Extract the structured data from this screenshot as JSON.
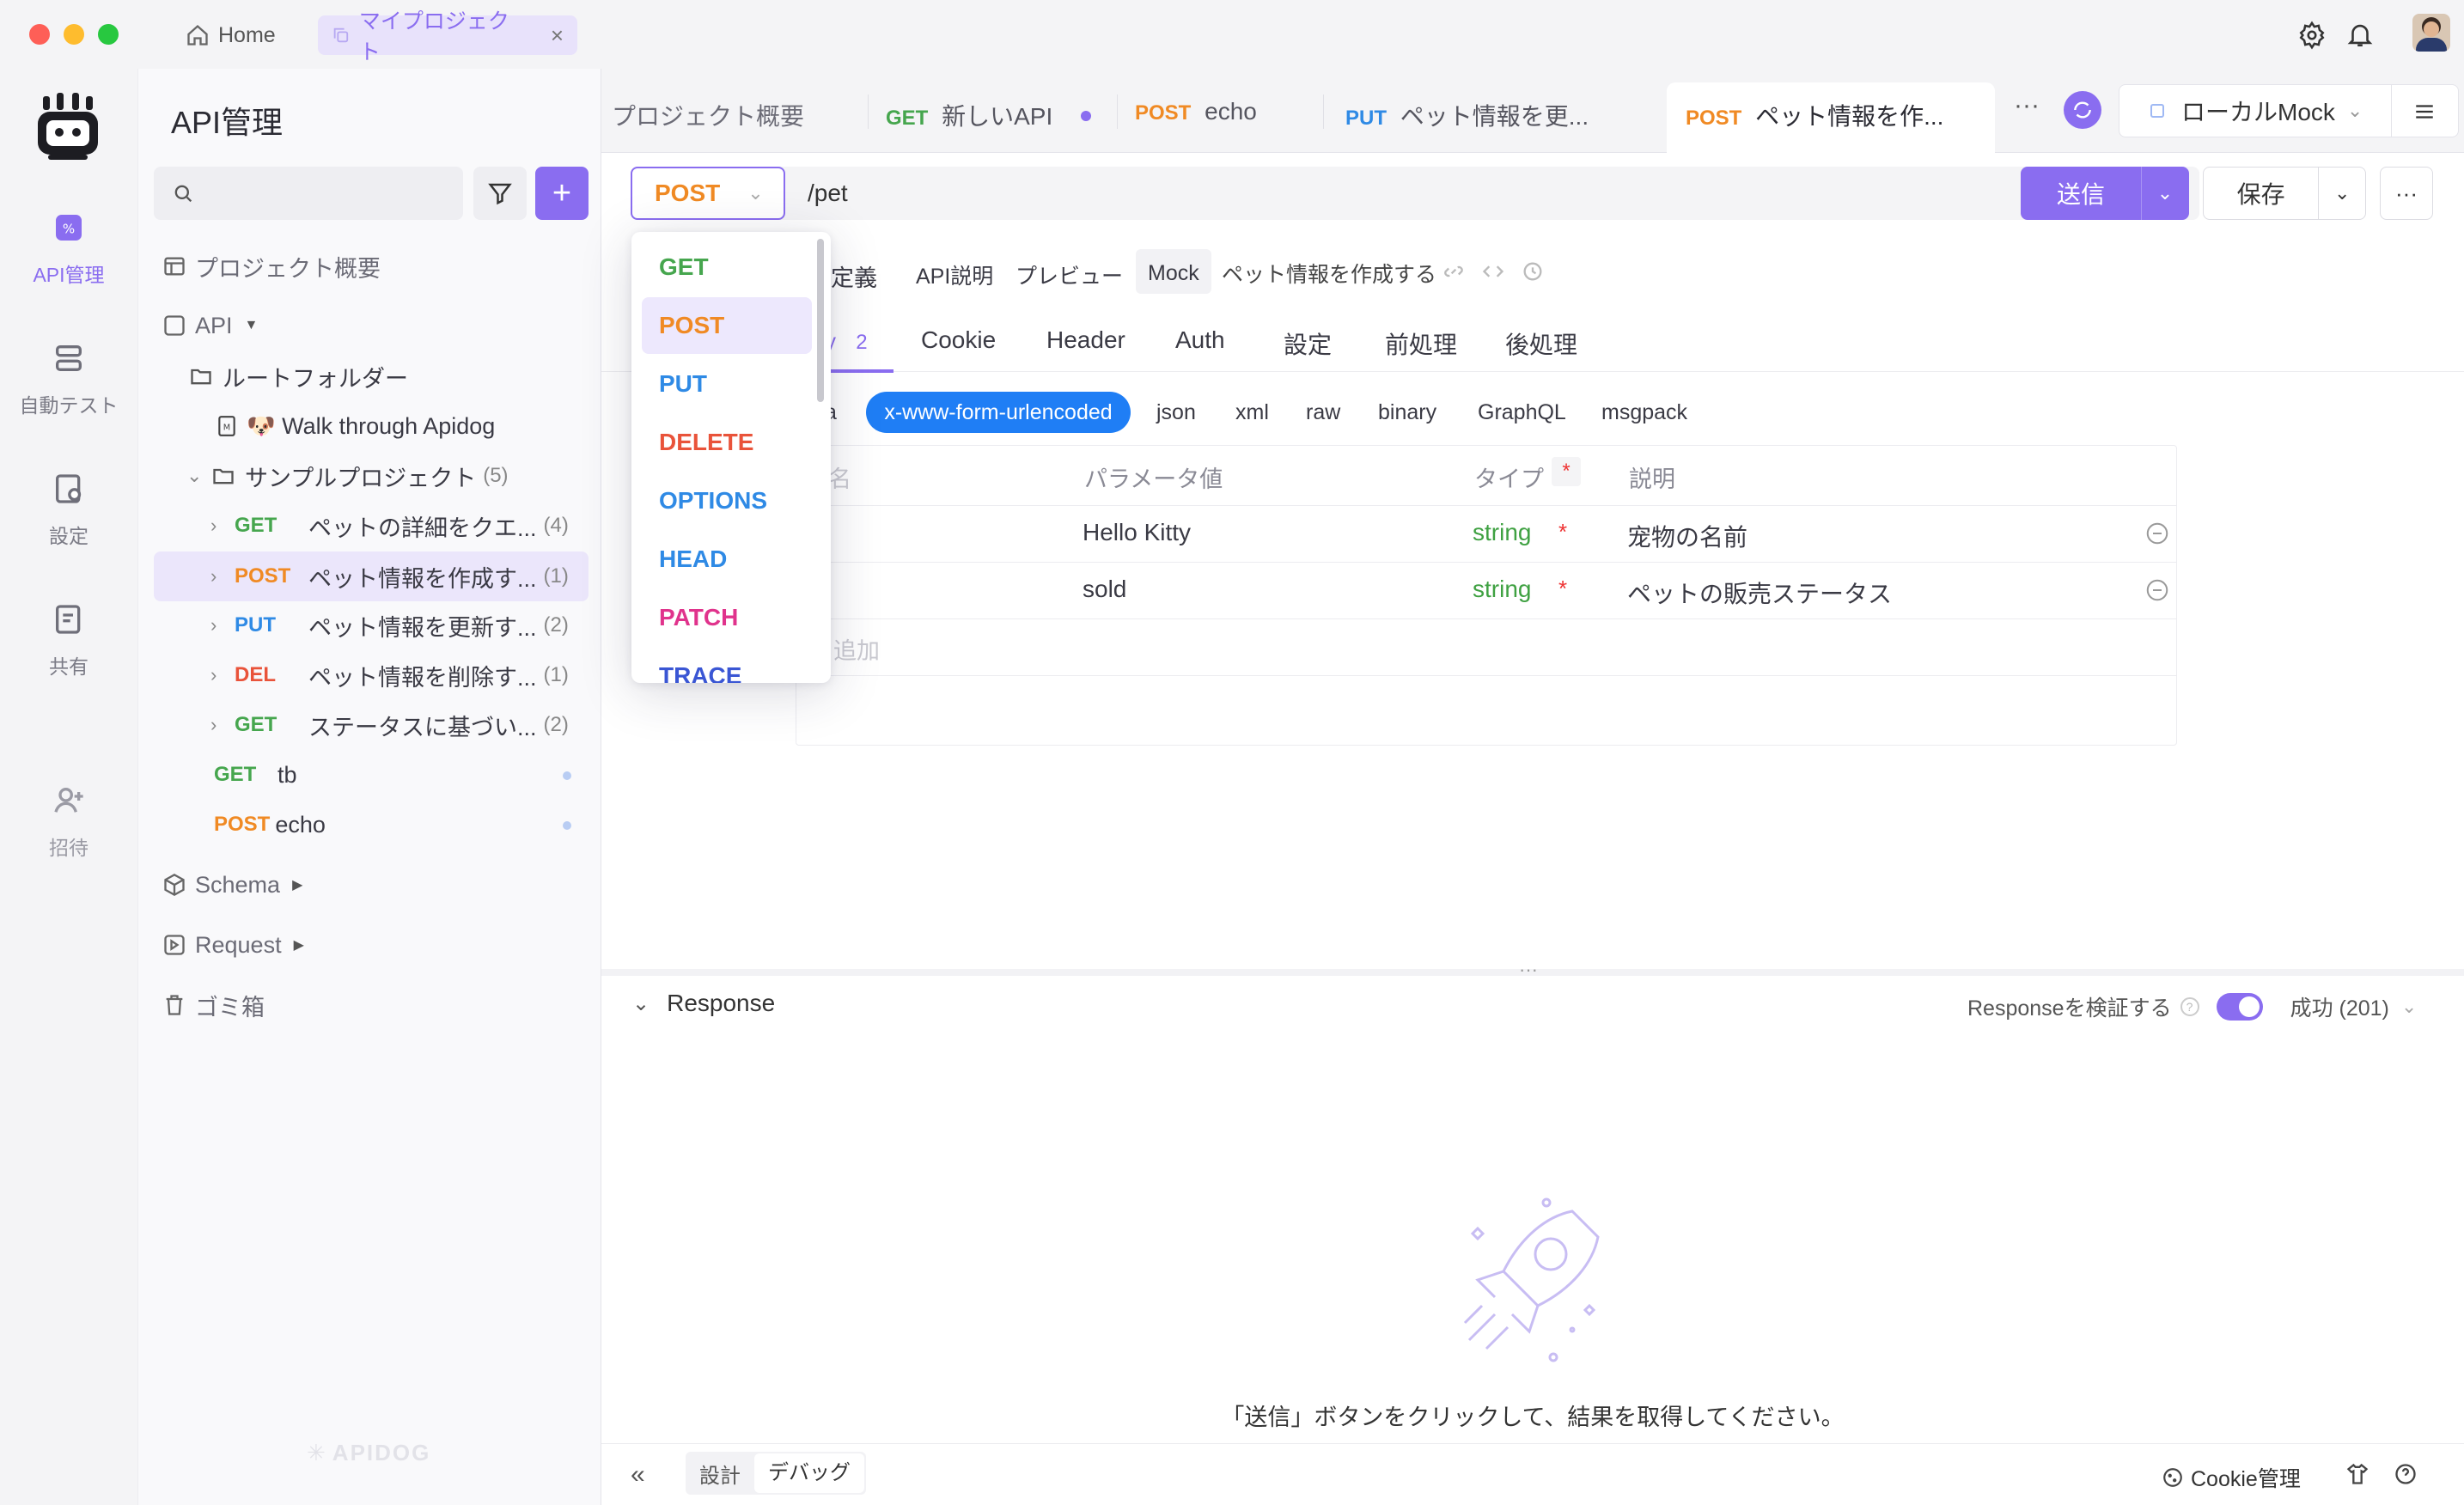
{
  "window": {
    "home_label": "Home",
    "project_tab": "マイプロジェクト"
  },
  "rail": {
    "items": [
      {
        "label": "API管理",
        "icon": "api-icon"
      },
      {
        "label": "自動テスト",
        "icon": "database-icon"
      },
      {
        "label": "設定",
        "icon": "settings-doc-icon"
      },
      {
        "label": "共有",
        "icon": "share-doc-icon"
      },
      {
        "label": "招待",
        "icon": "invite-user-icon"
      }
    ]
  },
  "sidebar": {
    "title": "API管理",
    "search_placeholder": "",
    "overview": "プロジェクト概要",
    "api": "API",
    "root_folder": "ルートフォルダー",
    "walk": "🐶 Walk through Apidog",
    "sample_project": "サンプルプロジェクト",
    "sample_count": "(5)",
    "endpoints": [
      {
        "method": "GET",
        "name": "ペットの詳細をクエ...",
        "count": "(4)"
      },
      {
        "method": "POST",
        "name": "ペット情報を作成す...",
        "count": "(1)"
      },
      {
        "method": "PUT",
        "name": "ペット情報を更新す...",
        "count": "(2)"
      },
      {
        "method": "DEL",
        "name": "ペット情報を削除す...",
        "count": "(1)"
      },
      {
        "method": "GET",
        "name": "ステータスに基づい...",
        "count": "(2)"
      }
    ],
    "extra": [
      {
        "method": "GET",
        "name": "tb"
      },
      {
        "method": "POST",
        "name": "echo"
      }
    ],
    "schema": "Schema",
    "request": "Request",
    "trash": "ゴミ箱",
    "watermark": "APIDOG"
  },
  "tabs": [
    {
      "method": "",
      "label": "プロジェクト概要"
    },
    {
      "method": "GET",
      "label": "新しいAPI"
    },
    {
      "method": "POST",
      "label": "echo"
    },
    {
      "method": "PUT",
      "label": "ペット情報を更..."
    },
    {
      "method": "POST",
      "label": "ペット情報を作..."
    }
  ],
  "env": {
    "label": "ローカルMock"
  },
  "request": {
    "method": "POST",
    "url": "/pet",
    "send": "送信",
    "save": "保存"
  },
  "subtabs": {
    "items": [
      "e定義",
      "API説明",
      "プレビュー",
      "Mock"
    ],
    "name": "ペット情報を作成する"
  },
  "param_tabs": {
    "body_count": "2",
    "items": [
      "Cookie",
      "Header",
      "Auth",
      "設定",
      "前処理",
      "後処理"
    ]
  },
  "body_types": {
    "partial": "a",
    "selected": "x-www-form-urlencoded",
    "items": [
      "json",
      "xml",
      "raw",
      "binary",
      "GraphQL",
      "msgpack"
    ]
  },
  "table": {
    "headers": [
      "パラメータ値",
      "タイプ",
      "説明"
    ],
    "rows": [
      {
        "value": "Hello Kitty",
        "type": "string",
        "desc": "宠物の名前"
      },
      {
        "value": "sold",
        "type": "string",
        "desc": "ペットの販売ステータス"
      }
    ],
    "add_partial": "追加"
  },
  "method_menu": [
    {
      "label": "GET",
      "color": "#46a64e"
    },
    {
      "label": "POST",
      "color": "#f08a24"
    },
    {
      "label": "PUT",
      "color": "#2f8ae5"
    },
    {
      "label": "DELETE",
      "color": "#e9533a"
    },
    {
      "label": "OPTIONS",
      "color": "#2f8ae5"
    },
    {
      "label": "HEAD",
      "color": "#2f8ae5"
    },
    {
      "label": "PATCH",
      "color": "#e0338c"
    },
    {
      "label": "TRACE",
      "color": "#3a56d4"
    }
  ],
  "response": {
    "title": "Response",
    "validate": "Responseを検証する",
    "status": "成功 (201)",
    "empty_text": "「送信」ボタンをクリックして、結果を取得してください。"
  },
  "footer": {
    "design": "設計",
    "debug": "デバッグ",
    "cookie": "Cookie管理"
  },
  "colors": {
    "accent": "#8a6df0",
    "accent_light": "#ede8fd"
  }
}
